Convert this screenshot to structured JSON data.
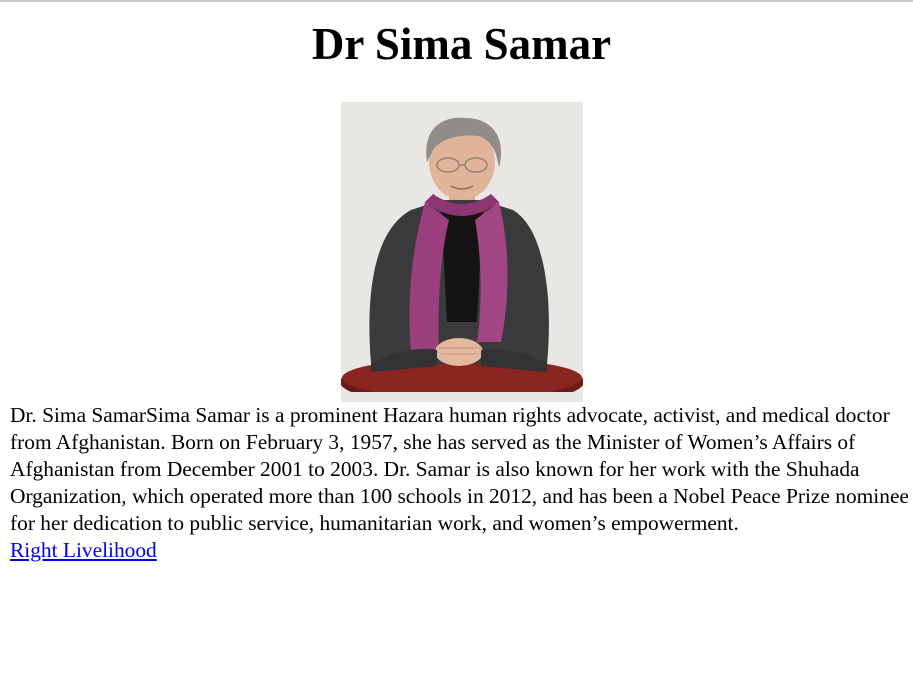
{
  "page": {
    "title": "Dr Sima Samar",
    "bio": "Dr. Sima SamarSima Samar is a prominent Hazara human rights advocate, activist, and medical doctor from Afghanistan. Born on February 3, 1957, she has served as the Minister of Women’s Affairs of Afghanistan from December 2001 to 2003. Dr. Samar is also known for her work with the Shuhada Organization, which operated more than 100 schools in 2012, and has been a Nobel Peace Prize nominee for her dedication to public service, humanitarian work, and women’s empowerment.",
    "link_label": "Right Livelihood"
  },
  "colors": {
    "link": "#0000ee",
    "scarf": "#9b3f7f",
    "jacket": "#3a3a3c",
    "table": "#7a1e1c",
    "photo_background": "#e7e5e2"
  }
}
